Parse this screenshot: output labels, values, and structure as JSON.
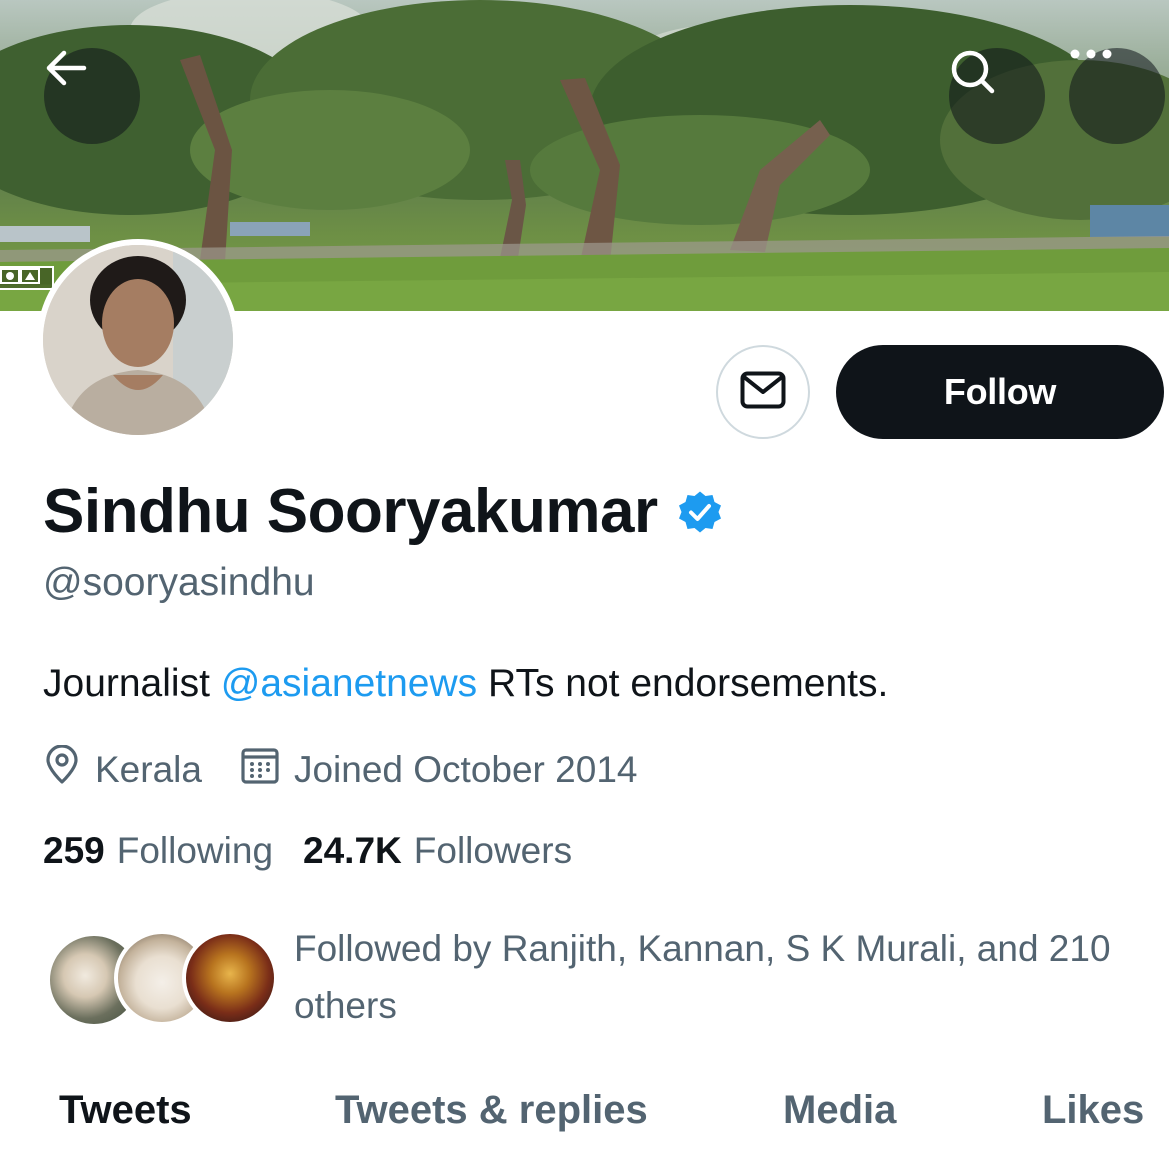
{
  "header": {
    "back_icon": "arrow-left-icon",
    "search_icon": "search-icon",
    "more_icon": "more-horizontal-icon"
  },
  "profile": {
    "name": "Sindhu Sooryakumar",
    "verified_icon": "verified-badge-icon",
    "verified_color": "#1d9bf0",
    "handle": "@sooryasindhu",
    "bio_prefix": "Journalist ",
    "bio_mention": "@asianetnews",
    "bio_suffix": " RTs not endorsements.",
    "location": "Kerala",
    "joined": "Joined October 2014",
    "following_count": "259",
    "following_label": "Following",
    "followers_count": "24.7K",
    "followers_label": "Followers",
    "followed_by": "Followed by Ranjith, Kannan, S K Murali, and 210 others"
  },
  "actions": {
    "message_icon": "mail-icon",
    "follow_label": "Follow"
  },
  "tabs": [
    {
      "label": "Tweets",
      "active": true
    },
    {
      "label": "Tweets & replies",
      "active": false
    },
    {
      "label": "Media",
      "active": false
    },
    {
      "label": "Likes",
      "active": false
    }
  ],
  "colors": {
    "primary_text": "#0f1419",
    "secondary_text": "#536471",
    "accent": "#1d9bf0",
    "follow_button_bg": "#0f1419"
  }
}
